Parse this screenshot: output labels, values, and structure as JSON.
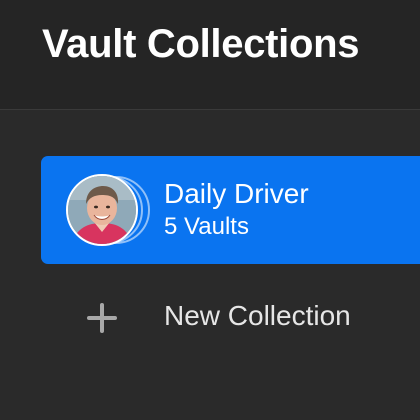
{
  "header": {
    "title": "Vault Collections"
  },
  "collections": [
    {
      "name": "Daily Driver",
      "count_label": "5 Vaults",
      "selected": true,
      "avatar_icon": "user-photo"
    }
  ],
  "actions": {
    "new_collection_label": "New Collection",
    "new_collection_icon": "plus-icon"
  },
  "colors": {
    "background": "#2a2a2a",
    "header_background": "#252525",
    "selected_accent": "#0a74f0",
    "text_primary": "#ffffff",
    "text_secondary": "#e6e6e6"
  }
}
